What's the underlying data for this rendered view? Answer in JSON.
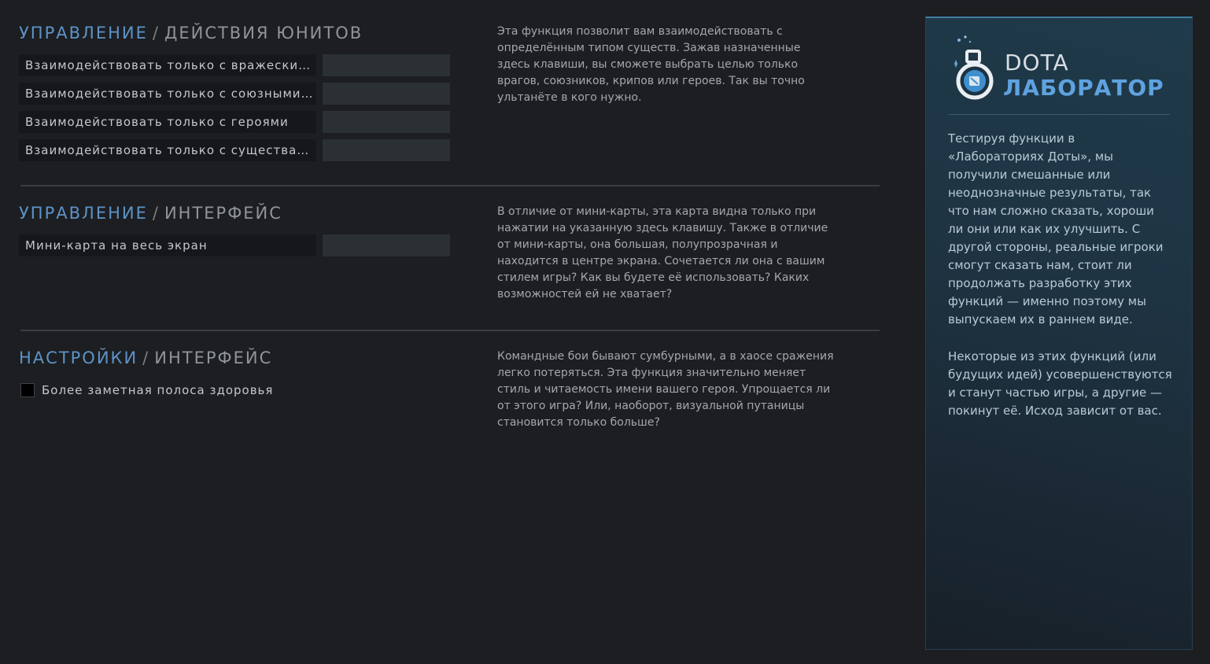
{
  "sections": [
    {
      "category": "УПРАВЛЕНИЕ",
      "separator": "/",
      "subcategory": "ДЕЙСТВИЯ ЮНИТОВ",
      "rows": [
        {
          "label": "Взаимодействовать только с вражески…",
          "key": ""
        },
        {
          "label": "Взаимодействовать только с союзными…",
          "key": ""
        },
        {
          "label": "Взаимодействовать только с героями",
          "key": ""
        },
        {
          "label": "Взаимодействовать только с существа…",
          "key": ""
        }
      ],
      "description": "Эта функция позволит вам взаимодействовать с определённым типом существ. Зажав назначенные здесь клавиши, вы сможете выбрать целью только врагов, союзников, крипов или героев. Так вы точно ультанёте в кого нужно."
    },
    {
      "category": "УПРАВЛЕНИЕ",
      "separator": "/",
      "subcategory": "ИНТЕРФЕЙС",
      "rows": [
        {
          "label": "Мини-карта на весь экран",
          "key": ""
        }
      ],
      "description": "В отличие от мини-карты, эта карта видна только при нажатии на указанную здесь клавишу. Также в отличие от мини-карты, она большая, полупрозрачная и находится в центре экрана. Сочетается ли она с вашим стилем игры? Как вы будете её использовать? Каких возможностей ей не хватает?"
    },
    {
      "category": "НАСТРОЙКИ",
      "separator": "/",
      "subcategory": "ИНТЕРФЕЙС",
      "checkbox": {
        "label": "Более заметная полоса здоровья",
        "checked": false
      },
      "description": "Командные бои бывают сумбурными, а в хаосе сражения легко потеряться. Эта функция значительно меняет стиль и читаемость имени вашего героя. Упрощается ли от этого игра? Или, наоборот, визуальной путаницы становится только больше?"
    }
  ],
  "panel": {
    "logo_line1": "DOTA",
    "logo_line2": "ЛАБОРАТОР",
    "logo_icon": "flask-icon",
    "paragraph1": "Тестируя функции в «Лабораториях Доты», мы получили смешанные или неоднозначные результаты, так что нам сложно сказать, хороши ли они или как их улучшить. С другой стороны, реальные игроки смогут сказать нам, стоит ли продолжать разработку этих функций — именно поэтому мы выпускаем их в раннем виде.",
    "paragraph2": "Некоторые из этих функций (или будущих идей) усовершенствуются и станут частью игры, а другие — покинут её. Исход зависит от вас."
  },
  "colors": {
    "background": "#1c1e21",
    "accent": "#5d93c8",
    "panel": "#1f3a4a",
    "logo_blue": "#5fa2e0"
  }
}
